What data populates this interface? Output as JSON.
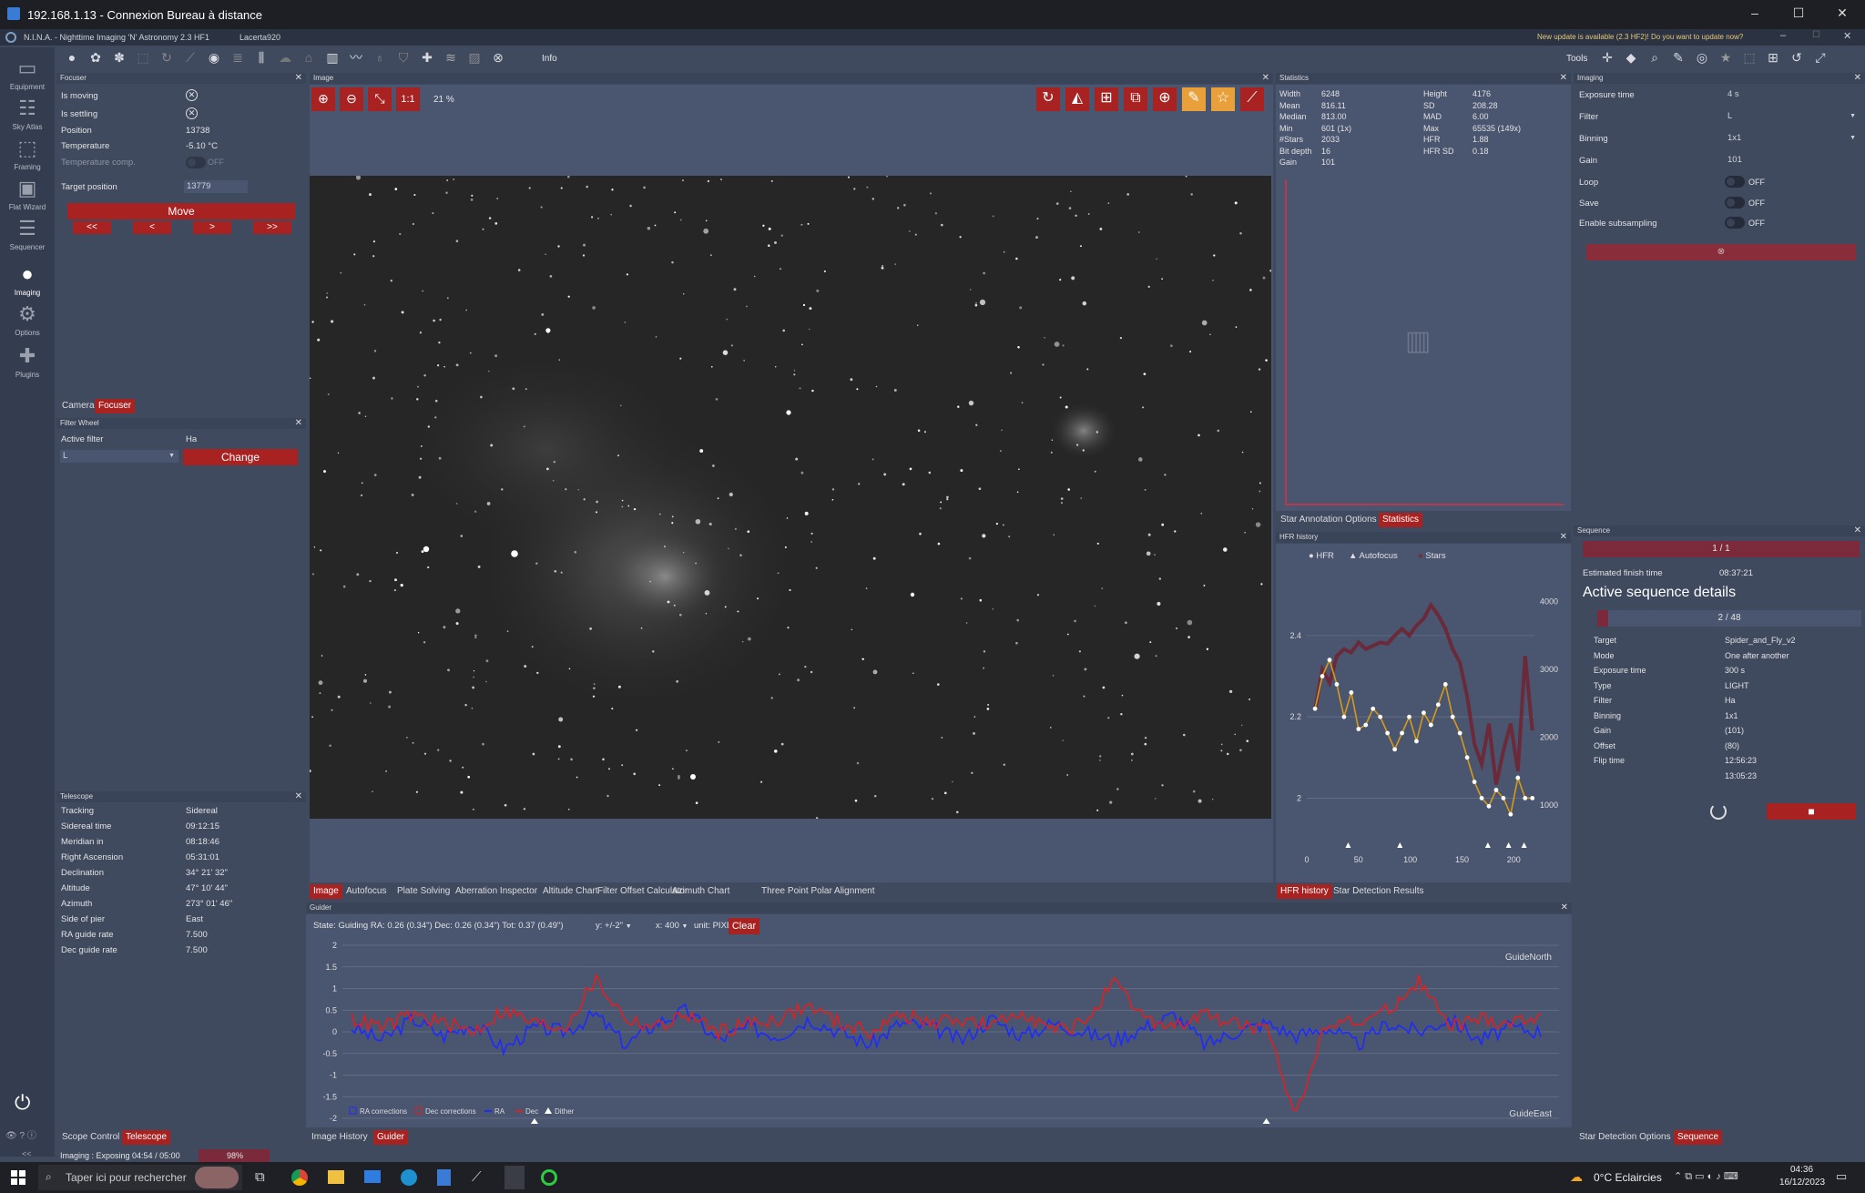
{
  "window": {
    "title": "192.168.1.13 - Connexion Bureau à distance",
    "min": "–",
    "max": "☐",
    "close": "✕"
  },
  "app": {
    "title": "N.I.N.A. - Nighttime Imaging 'N' Astronomy 2.3 HF1",
    "profile": "Lacerta920",
    "update_notice": "New update is available (2.3 HF2)! Do you want to update now?",
    "tools_label": "Tools",
    "info_label": "Info"
  },
  "sidebar": {
    "items": [
      {
        "label": "Equipment",
        "icon": "telescope-icon"
      },
      {
        "label": "Sky Atlas",
        "icon": "atlas-icon"
      },
      {
        "label": "Framing",
        "icon": "framing-icon"
      },
      {
        "label": "Flat Wizard",
        "icon": "flat-icon"
      },
      {
        "label": "Sequencer",
        "icon": "sequencer-icon"
      },
      {
        "label": "Imaging",
        "icon": "imaging-icon"
      },
      {
        "label": "Options",
        "icon": "gear-icon"
      },
      {
        "label": "Plugins",
        "icon": "puzzle-icon"
      }
    ]
  },
  "focuser": {
    "title": "Focuser",
    "is_moving_label": "Is moving",
    "is_settling_label": "Is settling",
    "position_label": "Position",
    "position": "13738",
    "temperature_label": "Temperature",
    "temperature": "-5.10 °C",
    "temp_comp_label": "Temperature comp.",
    "temp_comp": "OFF",
    "target_label": "Target position",
    "target": "13779",
    "move_label": "Move",
    "step_buttons": [
      "<<",
      "<",
      ">",
      ">>"
    ],
    "tabs": [
      "Camera",
      "Focuser"
    ]
  },
  "filter_wheel": {
    "title": "Filter Wheel",
    "active_label": "Active filter",
    "active": "Ha",
    "select_value": "L",
    "change_label": "Change"
  },
  "telescope": {
    "title": "Telescope",
    "rows": [
      [
        "Tracking",
        "Sidereal"
      ],
      [
        "Sidereal time",
        "09:12:15"
      ],
      [
        "Meridian in",
        "08:18:46"
      ],
      [
        "Right Ascension",
        "05:31:01"
      ],
      [
        "Declination",
        "34° 21' 32\""
      ],
      [
        "Altitude",
        "47° 10' 44\""
      ],
      [
        "Azimuth",
        "273° 01' 46\""
      ],
      [
        "Side of pier",
        "East"
      ],
      [
        "RA guide rate",
        "7.500"
      ],
      [
        "Dec guide rate",
        "7.500"
      ]
    ],
    "tabs": [
      "Scope Control",
      "Telescope"
    ]
  },
  "image_panel": {
    "title": "Image",
    "zoom": "21 %",
    "one_to_one": "1:1",
    "tabs": [
      "Image",
      "Autofocus",
      "Plate Solving",
      "Aberration Inspector",
      "Altitude Chart",
      "Filter Offset Calculator",
      "Azimuth Chart",
      "Three Point Polar Alignment"
    ]
  },
  "statistics": {
    "title": "Statistics",
    "left": [
      [
        "Width",
        "6248"
      ],
      [
        "Mean",
        "816.11"
      ],
      [
        "Median",
        "813.00"
      ],
      [
        "Min",
        "601 (1x)"
      ],
      [
        "#Stars",
        "2033"
      ],
      [
        "Bit depth",
        "16"
      ],
      [
        "Gain",
        "101"
      ]
    ],
    "right": [
      [
        "Height",
        "4176"
      ],
      [
        "SD",
        "208.28"
      ],
      [
        "MAD",
        "6.00"
      ],
      [
        "Max",
        "65535 (149x)"
      ],
      [
        "HFR",
        "1.88"
      ],
      [
        "HFR SD",
        "0.18"
      ]
    ],
    "tabs": [
      "Star Annotation Options",
      "Statistics"
    ]
  },
  "hfr": {
    "title": "HFR history",
    "legend": [
      "HFR",
      "Autofocus",
      "Stars"
    ],
    "tabs": [
      "HFR history",
      "Star Detection Results"
    ]
  },
  "imaging": {
    "title": "Imaging",
    "rows": [
      {
        "label": "Exposure time",
        "value": "4 s"
      },
      {
        "label": "Filter",
        "value": "L"
      },
      {
        "label": "Binning",
        "value": "1x1"
      },
      {
        "label": "Gain",
        "value": "101"
      },
      {
        "label": "Loop",
        "value": "OFF"
      },
      {
        "label": "Save",
        "value": "OFF"
      },
      {
        "label": "Enable subsampling",
        "value": "OFF"
      }
    ]
  },
  "sequence": {
    "title": "Sequence",
    "progress_label": "1 / 1",
    "finish_label": "Estimated finish time",
    "finish": "08:37:21",
    "heading": "Active sequence details",
    "item_progress": "2 / 48",
    "details": [
      [
        "Target",
        "Spider_and_Fly_v2"
      ],
      [
        "Mode",
        "One after another"
      ],
      [
        "Exposure time",
        "300 s"
      ],
      [
        "Type",
        "LIGHT"
      ],
      [
        "Filter",
        "Ha"
      ],
      [
        "Binning",
        "1x1"
      ],
      [
        "Gain",
        "(101)"
      ],
      [
        "Offset",
        "(80)"
      ],
      [
        "Flip time",
        "12:56:23"
      ],
      [
        "",
        "13:05:23"
      ]
    ],
    "tabs": [
      "Star Detection Options",
      "Sequence"
    ]
  },
  "guider": {
    "title": "Guider",
    "state": "State: Guiding  RA: 0.26 (0.34\")  Dec: 0.26 (0.34\")  Tot: 0.37 (0.49\")",
    "y_select": "y: +/-2\"",
    "x_select": "x: 400",
    "unit_select": "unit: PIXELS",
    "clear_label": "Clear",
    "north_label": "GuideNorth",
    "east_label": "GuideEast",
    "legend": [
      "RA corrections",
      "Dec corrections",
      "RA",
      "Dec",
      "Dither"
    ],
    "tabs": [
      "Image History",
      "Guider"
    ],
    "colors": {
      "ra": "#1e2bff",
      "dec": "#e02020"
    }
  },
  "status": {
    "text": "Imaging :   Exposing 04:54 / 05:00",
    "percent": "98%",
    "progress": 0.98
  },
  "taskbar": {
    "search_placeholder": "Taper ici pour rechercher",
    "weather": "0°C  Eclaircies",
    "time": "04:36",
    "date": "16/12/2023"
  },
  "chart_data": [
    {
      "type": "line",
      "title": "HFR history",
      "x_ticks": [
        "0",
        "50",
        "100",
        "150",
        "200"
      ],
      "y_left_ticks": [
        "2",
        "2.2",
        "2.4"
      ],
      "y_right_ticks": [
        "1000",
        "2000",
        "3000",
        "4000"
      ],
      "series": [
        {
          "name": "HFR",
          "values": [
            2.22,
            2.3,
            2.34,
            2.28,
            2.2,
            2.26,
            2.17,
            2.18,
            2.22,
            2.2,
            2.16,
            2.12,
            2.16,
            2.2,
            2.14,
            2.21,
            2.18,
            2.23,
            2.28,
            2.2,
            2.16,
            2.1,
            2.04,
            2.0,
            1.98,
            2.02,
            2.0,
            1.96,
            2.05,
            2.0,
            2.0
          ]
        },
        {
          "name": "Stars",
          "values": [
            2400,
            3000,
            2800,
            3200,
            3300,
            3250,
            3400,
            3300,
            3350,
            3400,
            3380,
            3500,
            3600,
            3500,
            3650,
            3750,
            3950,
            3800,
            3600,
            3300,
            3100,
            2600,
            1900,
            1600,
            2200,
            1300,
            1800,
            2200,
            1500,
            3200,
            2100
          ]
        }
      ],
      "autofocus_markers": [
        40,
        90,
        175,
        195,
        210
      ]
    },
    {
      "type": "line",
      "title": "Guider",
      "y_ticks": [
        "2",
        "1.5",
        "1",
        "0.5",
        "0",
        "-0.5",
        "-1",
        "-1.5",
        "-2"
      ],
      "ylim": [
        -2,
        2
      ],
      "series": [
        {
          "name": "RA",
          "values": [
            0.1,
            -0.2,
            0.3,
            -0.1,
            0.2,
            -0.4,
            0.1,
            0.0,
            0.4,
            -0.3,
            0.2,
            0.5,
            -0.2,
            0.1,
            -0.1,
            0.3,
            0.0,
            -0.3,
            0.2,
            0.1,
            -0.2,
            0.3,
            -0.1,
            0.2,
            0.0,
            -0.2,
            0.1,
            0.4,
            -0.3,
            0.0,
            0.2,
            -0.1,
            0.1,
            -0.3,
            0.2,
            0.0,
            0.3,
            -0.2,
            0.1,
            0.0
          ]
        },
        {
          "name": "Dec",
          "values": [
            0.3,
            0.1,
            0.4,
            0.2,
            0.0,
            0.5,
            0.2,
            0.1,
            1.2,
            0.3,
            0.1,
            0.4,
            0.0,
            0.2,
            0.3,
            0.6,
            0.2,
            0.0,
            0.4,
            0.2,
            0.3,
            0.1,
            0.5,
            0.0,
            0.2,
            1.1,
            0.3,
            0.1,
            0.4,
            0.2,
            0.0,
            -1.9,
            0.3,
            0.2,
            0.5,
            1.2,
            0.1,
            0.3,
            0.2,
            0.4
          ]
        }
      ],
      "dither_markers": [
        6,
        30
      ]
    }
  ]
}
